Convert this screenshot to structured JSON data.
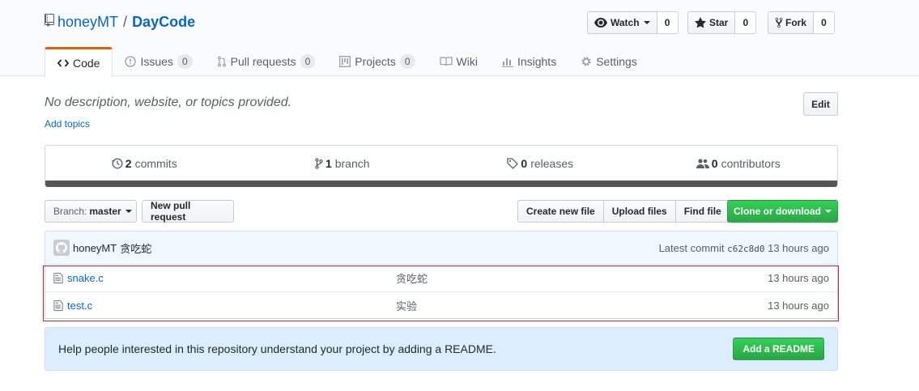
{
  "repo": {
    "owner": "honeyMT",
    "separator": "/",
    "name": "DayCode"
  },
  "actions": {
    "watch": {
      "label": "Watch",
      "count": "0"
    },
    "star": {
      "label": "Star",
      "count": "0"
    },
    "fork": {
      "label": "Fork",
      "count": "0"
    }
  },
  "tabs": [
    {
      "label": "Code",
      "icon": "code-icon"
    },
    {
      "label": "Issues",
      "counter": "0",
      "icon": "issue-icon"
    },
    {
      "label": "Pull requests",
      "counter": "0",
      "icon": "pull-request-icon"
    },
    {
      "label": "Projects",
      "counter": "0",
      "icon": "project-icon"
    },
    {
      "label": "Wiki",
      "icon": "book-icon"
    },
    {
      "label": "Insights",
      "icon": "graph-icon"
    },
    {
      "label": "Settings",
      "icon": "gear-icon"
    }
  ],
  "description": "No description, website, or topics provided.",
  "add_topics": "Add topics",
  "edit_label": "Edit",
  "summary": {
    "commits": {
      "num": "2",
      "label": "commits"
    },
    "branches": {
      "num": "1",
      "label": "branch"
    },
    "releases": {
      "num": "0",
      "label": "releases"
    },
    "contributors": {
      "num": "0",
      "label": "contributors"
    },
    "language_bar_color": "#555555"
  },
  "file_nav": {
    "branch_prefix": "Branch:",
    "branch": "master",
    "new_pull_request": "New pull request",
    "create_new_file": "Create new file",
    "upload_files": "Upload files",
    "find_file": "Find file",
    "clone": "Clone or download"
  },
  "latest_commit": {
    "author": "honeyMT",
    "message": "贪吃蛇",
    "prefix": "Latest commit",
    "sha": "c62c8d0",
    "age": "13 hours ago"
  },
  "files": [
    {
      "name": "snake.c",
      "message": "贪吃蛇",
      "age": "13 hours ago"
    },
    {
      "name": "test.c",
      "message": "实验",
      "age": "13 hours ago"
    }
  ],
  "readme_prompt": {
    "text": "Help people interested in this repository understand your project by adding a README.",
    "button": "Add a README"
  },
  "colors": {
    "link": "#0366d6",
    "accent": "#e36209",
    "green": "#28a745",
    "highlight_border": "#d0202a"
  }
}
